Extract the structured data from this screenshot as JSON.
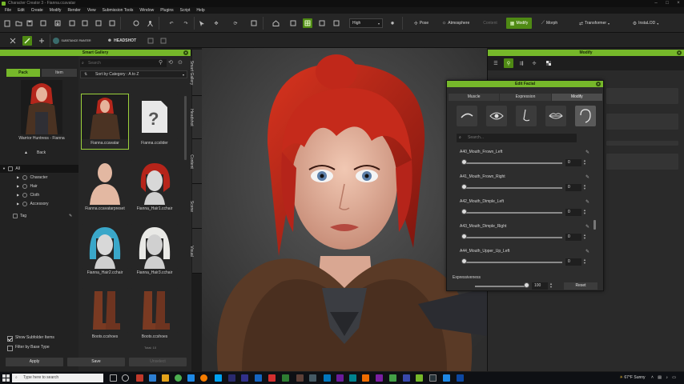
{
  "window": {
    "title": "Character Creator 3 - Fianna.ccavatar"
  },
  "menu": [
    "File",
    "Edit",
    "Create",
    "Modify",
    "Render",
    "View",
    "Submission Tools",
    "Window",
    "Plugins",
    "Script",
    "Help"
  ],
  "toolbar": {
    "quality": "High",
    "pose": "Pose",
    "atmosphere": "Atmosphere",
    "content": "Content",
    "modify": "Modify",
    "morph": "Morph",
    "transformer": "Transformer",
    "instalod": "InstaLOD",
    "substance": "SUBSTANCE PAINTER",
    "headshot": "HEADSHOT"
  },
  "gallery": {
    "title": "Smart Gallery",
    "tab_pack": "Pack",
    "tab_item": "Item",
    "search_placeholder": "Search",
    "sort_label": "Sort by Category : A to Z",
    "preview_caption": "Warrior Huntress - Fianna",
    "back": "Back",
    "tree": [
      "All",
      "Character",
      "Hair",
      "Cloth",
      "Accessory",
      "Tag"
    ],
    "items": [
      "Fianna.ccavatar",
      "Fianna.ccslider",
      "Fianna.ccavatarpreset",
      "Fianna_Hair1.cchair",
      "Fianna_Hair2.cchair",
      "Fianna_Hair3.cchair",
      "Boots.ccshoes",
      "Boots.ccshoes"
    ],
    "show_subfolder": "Show Subfolder Items",
    "filter_base": "Filter by Base Type",
    "apply": "Apply",
    "save": "Save",
    "unselect": "Unselect",
    "page": "Total: 10"
  },
  "side_tabs": [
    "Smart Gallery",
    "Headshot",
    "Content",
    "Scene",
    "Visual"
  ],
  "modify_panel": {
    "title": "Modify"
  },
  "edit_facial": {
    "title": "Edit Facial",
    "tabs": [
      "Muscle",
      "Expression",
      "Modify"
    ],
    "search_placeholder": "Search...",
    "sliders": [
      {
        "label": "A40_Mouth_Frown_Left",
        "value": "0"
      },
      {
        "label": "A41_Mouth_Frown_Right",
        "value": "0"
      },
      {
        "label": "A42_Mouth_Dimple_Left",
        "value": "0"
      },
      {
        "label": "A43_Mouth_Dimple_Right",
        "value": "0"
      },
      {
        "label": "A44_Mouth_Upper_Up_Left",
        "value": "0"
      }
    ],
    "expressiveness_label": "Expressiveness",
    "expressiveness_value": "100",
    "reset": "Reset"
  },
  "taskbar": {
    "search_placeholder": "Type here to search",
    "weather": "67°F Sunny"
  },
  "colors": {
    "accent": "#76b82a",
    "hair": "#c4261b",
    "fur": "#4a2f1f",
    "skin": "#e7b9a3"
  }
}
